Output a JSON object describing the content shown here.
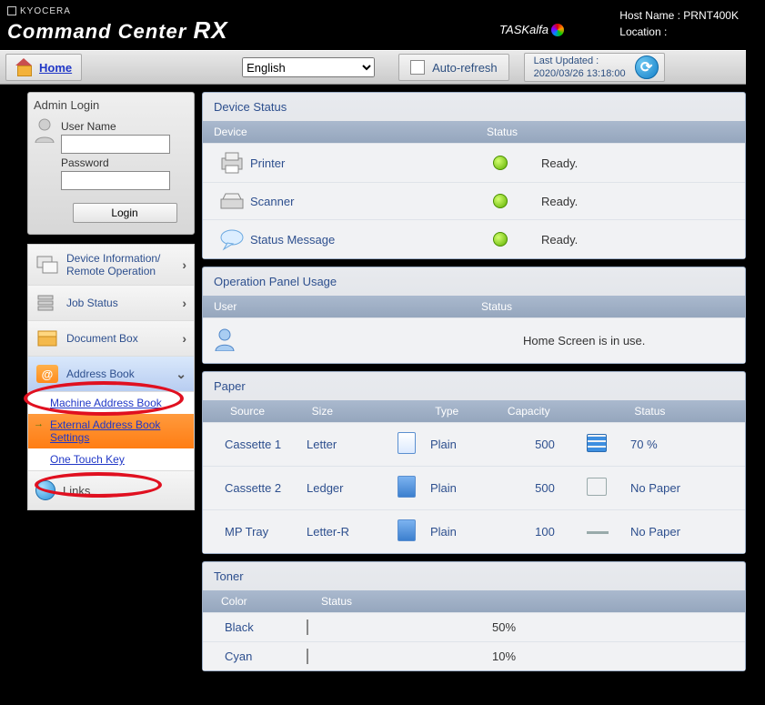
{
  "header": {
    "kyocera": "KYOCERA",
    "title": "Command Center ",
    "title_rx": "RX",
    "taskalfa": "TASKalfa",
    "host_label": "Host Name : ",
    "host_value": "PRNT400K",
    "location_label": "Location :",
    "location_value": ""
  },
  "toolbar": {
    "home": "Home",
    "language": "English",
    "autorefresh": "Auto-refresh",
    "last_updated_label": "Last Updated :",
    "last_updated_value": "2020/03/26 13:18:00"
  },
  "login": {
    "title": "Admin Login",
    "user_label": "User Name",
    "pass_label": "Password",
    "button": "Login"
  },
  "nav": {
    "device_info": "Device Information/\nRemote Operation",
    "job_status": "Job Status",
    "doc_box": "Document Box",
    "address_book": "Address Book",
    "machine_ab": "Machine Address Book",
    "external_ab": "External Address Book Settings",
    "one_touch": "One Touch Key",
    "links": "Links"
  },
  "device_status": {
    "title": "Device Status",
    "cols": {
      "device": "Device",
      "status": "Status"
    },
    "rows": [
      {
        "name": "Printer",
        "status": "Ready."
      },
      {
        "name": "Scanner",
        "status": "Ready."
      },
      {
        "name": "Status Message",
        "status": "Ready."
      }
    ]
  },
  "op_panel": {
    "title": "Operation Panel Usage",
    "cols": {
      "user": "User",
      "status": "Status"
    },
    "status_text": "Home Screen is in use."
  },
  "paper": {
    "title": "Paper",
    "cols": {
      "source": "Source",
      "size": "Size",
      "type": "Type",
      "capacity": "Capacity",
      "status": "Status"
    },
    "rows": [
      {
        "source": "Cassette 1",
        "size": "Letter",
        "type": "Plain",
        "capacity": "500",
        "status": "70 %"
      },
      {
        "source": "Cassette 2",
        "size": "Ledger",
        "type": "Plain",
        "capacity": "500",
        "status": "No Paper"
      },
      {
        "source": "MP Tray",
        "size": "Letter-R",
        "type": "Plain",
        "capacity": "100",
        "status": "No Paper"
      }
    ]
  },
  "toner": {
    "title": "Toner",
    "cols": {
      "color": "Color",
      "status": "Status"
    },
    "rows": [
      {
        "color": "Black",
        "pct": "50%",
        "fill": 50,
        "hex": "#000000"
      },
      {
        "color": "Cyan",
        "pct": "10%",
        "fill": 10,
        "hex": "#2a8fe0"
      }
    ]
  }
}
